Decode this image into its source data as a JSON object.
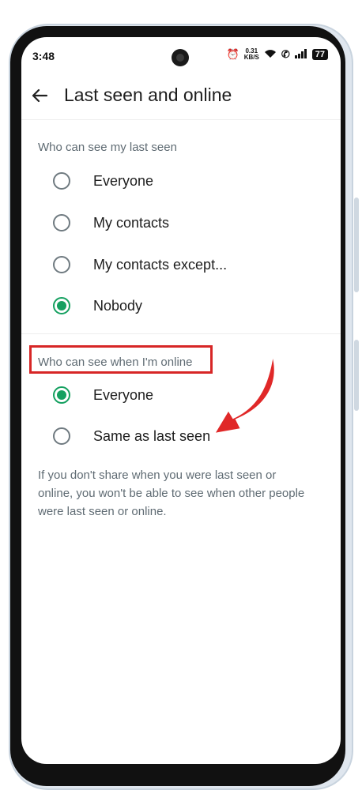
{
  "status_bar": {
    "time": "3:48",
    "network_speed_value": "0.31",
    "network_speed_unit": "KB/S",
    "battery": "77"
  },
  "header": {
    "title": "Last seen and online"
  },
  "last_seen": {
    "heading": "Who can see my last seen",
    "options": [
      {
        "label": "Everyone",
        "checked": false
      },
      {
        "label": "My contacts",
        "checked": false
      },
      {
        "label": "My contacts except...",
        "checked": false
      },
      {
        "label": "Nobody",
        "checked": true
      }
    ]
  },
  "online": {
    "heading": "Who can see when I'm online",
    "options": [
      {
        "label": "Everyone",
        "checked": true
      },
      {
        "label": "Same as last seen",
        "checked": false
      }
    ]
  },
  "footnote": "If you don't share when you were last seen or online, you won't be able to see when other people were last seen or online.",
  "colors": {
    "accent": "#15a060",
    "annotation": "#d72626"
  }
}
